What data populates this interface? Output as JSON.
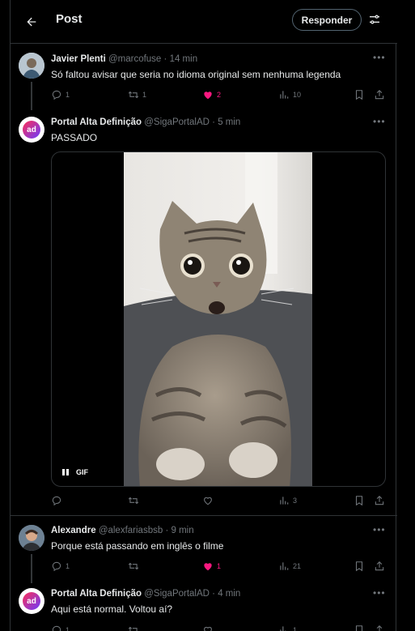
{
  "header": {
    "title": "Post",
    "reply_button": "Responder"
  },
  "tweets": [
    {
      "name": "Javier Plenti",
      "handle": "@marcofuse",
      "time": "· 14 min",
      "text": "Só faltou avisar que seria no idioma original sem nenhuma legenda",
      "replies": "1",
      "retweets": "1",
      "likes": "2",
      "views": "10",
      "liked": true
    },
    {
      "name": "Portal Alta Definição",
      "handle": "@SigaPortalAD",
      "time": "· 5 min",
      "text": "PASSADO",
      "replies": "",
      "retweets": "",
      "likes": "",
      "views": "3",
      "media_label": "GIF"
    },
    {
      "name": "Alexandre",
      "handle": "@alexfariasbsb",
      "time": "· 9 min",
      "text": "Porque está passando em inglês o filme",
      "replies": "1",
      "retweets": "",
      "likes": "1",
      "views": "21",
      "liked": true
    },
    {
      "name": "Portal Alta Definição",
      "handle": "@SigaPortalAD",
      "time": "· 4 min",
      "text": "Aqui está normal. Voltou aí?",
      "replies": "1",
      "retweets": "",
      "likes": "",
      "views": "1"
    }
  ],
  "portal_avatar_text": "ad",
  "colors": {
    "like": "#f91880",
    "muted": "#71767b",
    "border": "#2f3336",
    "avatar_gradient": [
      "#ff2d55",
      "#6a3cff"
    ]
  }
}
